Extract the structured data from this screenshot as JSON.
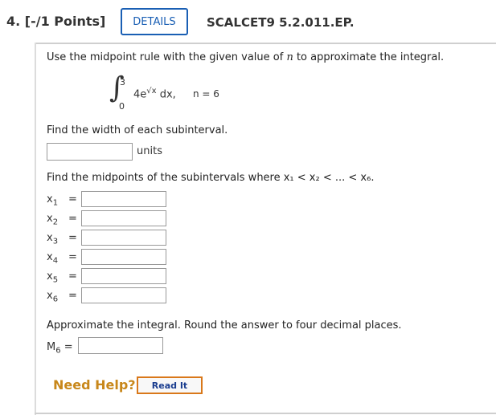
{
  "header": {
    "question_number": "4. [-/1 Points]",
    "details_label": "DETAILS",
    "problem_code": "SCALCET9 5.2.011.EP."
  },
  "prompt": {
    "instruction_pre": "Use the midpoint rule with the given value of ",
    "instruction_var": "n",
    "instruction_post": " to approximate the integral."
  },
  "integral": {
    "upper_limit": "3",
    "lower_limit": "0",
    "coefficient": "4e",
    "exponent": "√x",
    "differential": "dx,",
    "n_value": "n = 6"
  },
  "width_question": {
    "text": "Find the width of each subinterval.",
    "input_value": "",
    "units_label": "units"
  },
  "midpoints_question": {
    "text": "Find the midpoints of the subintervals where x₁ < x₂ < ... < x₆.",
    "rows": [
      {
        "label": "x",
        "sub": "1",
        "eq": "=",
        "value": ""
      },
      {
        "label": "x",
        "sub": "2",
        "eq": "=",
        "value": ""
      },
      {
        "label": "x",
        "sub": "3",
        "eq": "=",
        "value": ""
      },
      {
        "label": "x",
        "sub": "4",
        "eq": "=",
        "value": ""
      },
      {
        "label": "x",
        "sub": "5",
        "eq": "=",
        "value": ""
      },
      {
        "label": "x",
        "sub": "6",
        "eq": "=",
        "value": ""
      }
    ]
  },
  "approx_question": {
    "text": "Approximate the integral. Round the answer to four decimal places.",
    "label": "M",
    "sub": "6",
    "eq": "=",
    "input_value": ""
  },
  "help": {
    "need_help_label": "Need Help?",
    "read_it_label": "Read It"
  },
  "colors": {
    "details_border": "#1a5fb4",
    "need_help": "#c8871a",
    "read_it_border": "#d9781a"
  }
}
